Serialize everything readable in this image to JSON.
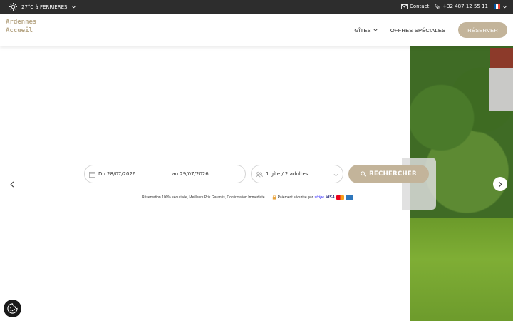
{
  "topbar": {
    "weather": "27°C à FERRIERES",
    "contact": "Contact",
    "phone": "+32 487 12 55 11"
  },
  "header": {
    "logo_line1": "Ardennes",
    "logo_line2": "Accueil",
    "nav_gites": "GÎTES",
    "nav_offres": "OFFRES SPÉCIALES",
    "reserve": "RÉSERVER"
  },
  "search": {
    "date_from": "Du 28/07/2026",
    "date_to": "au 29/07/2026",
    "guests": "1 gîte / 2 adultes",
    "button": "RECHERCHER"
  },
  "reassurance": {
    "text": "Réservation 100% sécurisée, Meilleurs Prix Garantis, Confirmation Immédiate",
    "payment": "Paiement sécurisé par",
    "stripe": "stripe",
    "visa": "VISA"
  },
  "colors": {
    "accent": "#c3b49a",
    "topbar": "#2d2d2d"
  },
  "icons": [
    "sun-icon",
    "chevron-down-icon",
    "mail-icon",
    "phone-icon",
    "flag-fr-icon",
    "calendar-icon",
    "users-icon",
    "search-icon",
    "chevron-left-icon",
    "chevron-right-icon",
    "lock-icon",
    "cookie-icon"
  ]
}
